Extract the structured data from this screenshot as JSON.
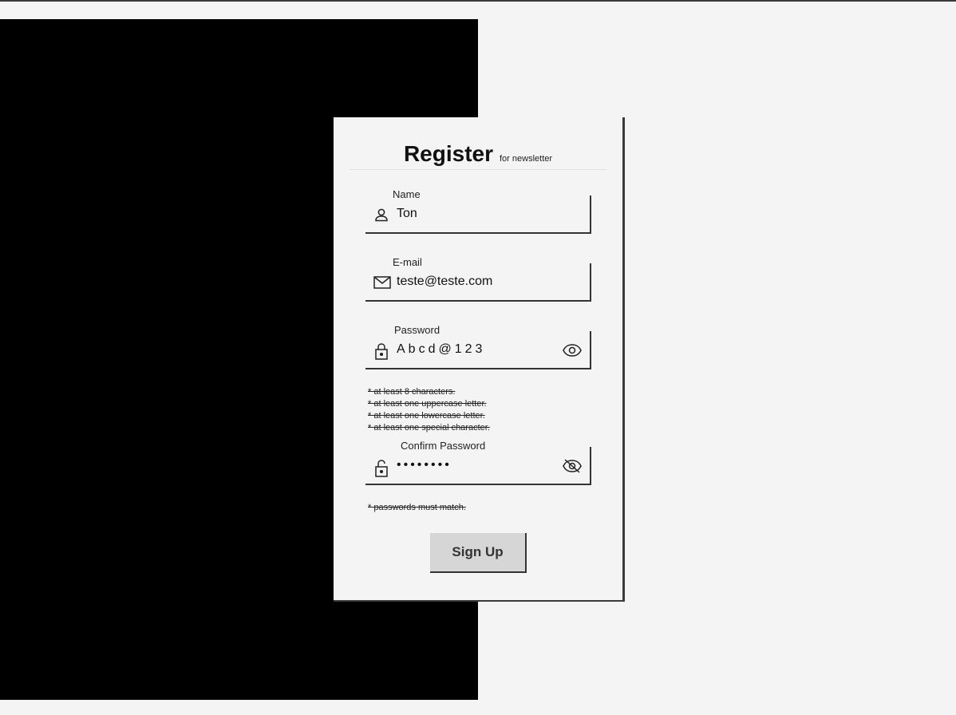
{
  "form": {
    "title": "Register",
    "subtitle": "for newsletter",
    "fields": {
      "name": {
        "label": "Name",
        "value": "Ton",
        "icon": "user-icon"
      },
      "email": {
        "label": "E-mail",
        "value": "teste@teste.com",
        "icon": "mail-icon"
      },
      "password": {
        "label": "Password",
        "value": "Abcd@123",
        "icon": "lock-icon",
        "toggle_icon": "eye-icon"
      },
      "confirm_password": {
        "label": "Confirm Password",
        "value": "••••••••",
        "icon": "unlock-icon",
        "toggle_icon": "eye-off-icon"
      }
    },
    "password_rules": [
      "* at least 8 characters.",
      "* at least one uppercase letter.",
      "* at least one lowercase letter.",
      "* at least one special character."
    ],
    "confirm_rule": "* passwords must match.",
    "submit_label": "Sign Up"
  }
}
